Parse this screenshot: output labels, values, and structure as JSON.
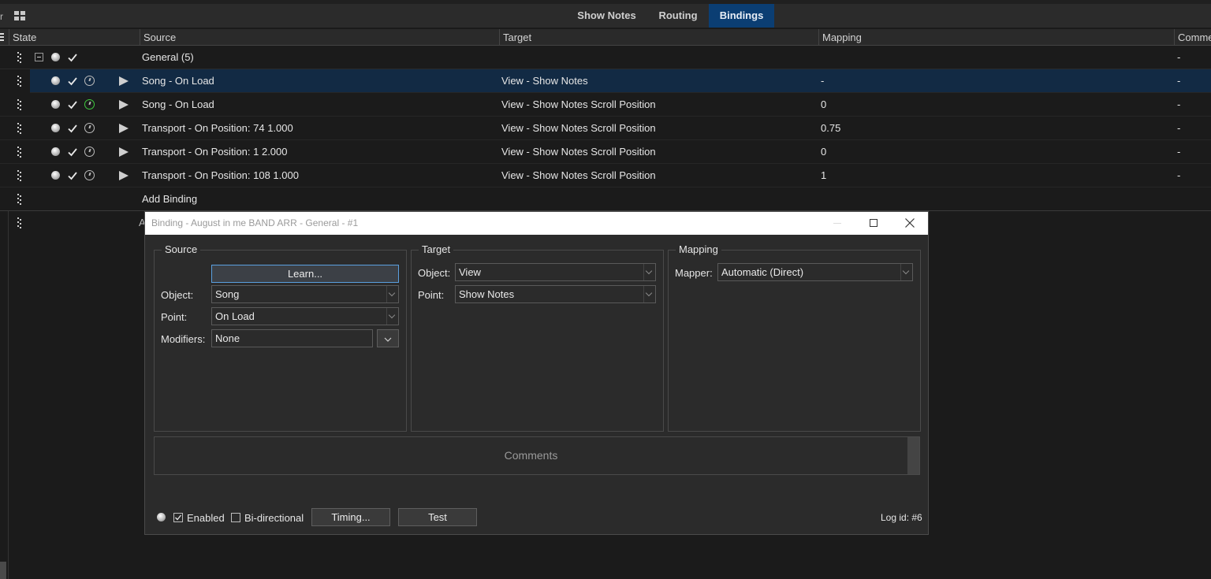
{
  "top_tabs": [
    {
      "label": "Show Notes",
      "active": false
    },
    {
      "label": "Routing",
      "active": false
    },
    {
      "label": "Bindings",
      "active": true
    }
  ],
  "left_edge_glyph": "r",
  "table": {
    "columns": [
      "State",
      "Source",
      "Target",
      "Mapping",
      "Comme"
    ],
    "group": {
      "label": "General (5)",
      "comment": "-"
    },
    "rows": [
      {
        "source": "Song - On Load",
        "target": "View - Show Notes",
        "mapping": "-",
        "comment": "-",
        "selected": true,
        "timer_color": "#bcbcbc"
      },
      {
        "source": "Song - On Load",
        "target": "View - Show Notes Scroll Position",
        "mapping": "0",
        "comment": "-",
        "selected": false,
        "timer_color": "#3ecb3e"
      },
      {
        "source": "Transport - On Position: 74 1.000",
        "target": "View - Show Notes Scroll Position",
        "mapping": "0.75",
        "comment": "-",
        "selected": false,
        "timer_color": "#bcbcbc"
      },
      {
        "source": "Transport - On Position: 1 2.000",
        "target": "View - Show Notes Scroll Position",
        "mapping": "0",
        "comment": "-",
        "selected": false,
        "timer_color": "#bcbcbc"
      },
      {
        "source": "Transport - On Position: 108 1.000",
        "target": "View - Show Notes Scroll Position",
        "mapping": "1",
        "comment": "-",
        "selected": false,
        "timer_color": "#bcbcbc"
      }
    ],
    "add_binding_label": "Add Binding",
    "hidden_row_label": "A"
  },
  "dialog": {
    "title": "Binding - August in me BAND ARR - General - #1",
    "source": {
      "legend": "Source",
      "learn_label": "Learn...",
      "object_label": "Object:",
      "object_value": "Song",
      "point_label": "Point:",
      "point_value": "On Load",
      "modifiers_label": "Modifiers:",
      "modifiers_value": "None"
    },
    "target": {
      "legend": "Target",
      "object_label": "Object:",
      "object_value": "View",
      "point_label": "Point:",
      "point_value": "Show Notes"
    },
    "mapping": {
      "legend": "Mapping",
      "mapper_label": "Mapper:",
      "mapper_value": "Automatic (Direct)"
    },
    "comments_placeholder": "Comments",
    "enabled_label": "Enabled",
    "enabled_checked": true,
    "bidirectional_label": "Bi-directional",
    "bidirectional_checked": false,
    "timing_label": "Timing...",
    "test_label": "Test",
    "log_id": "Log id: #6"
  },
  "colors": {
    "accent_tab": "#0b3e73",
    "selected_row": "#122a44",
    "active_timer": "#3ecb3e",
    "background": "#1b1b1b"
  }
}
